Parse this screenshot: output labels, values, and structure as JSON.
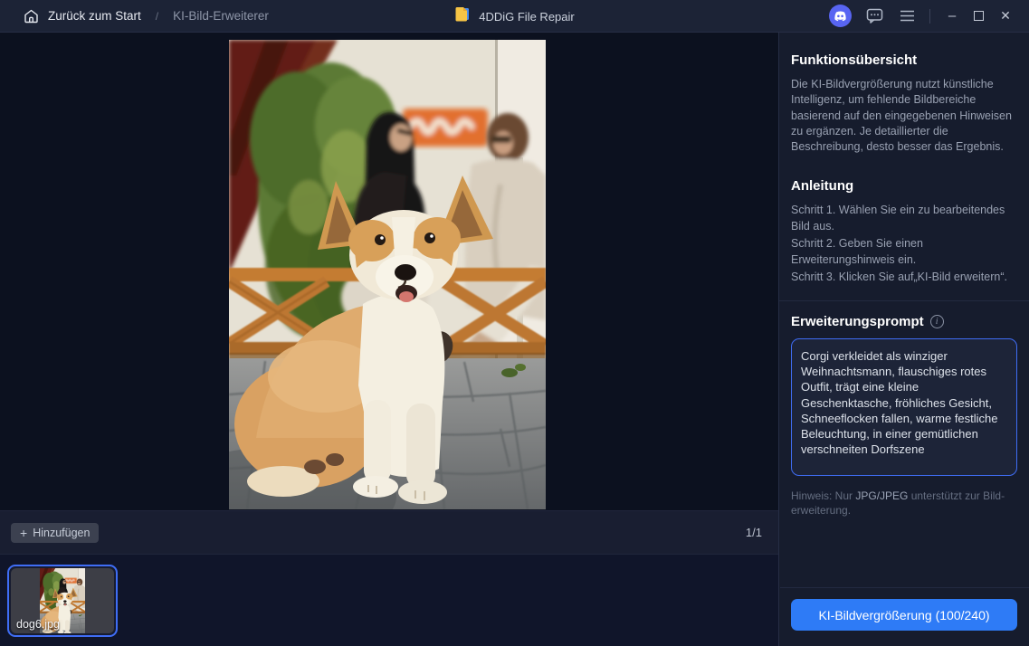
{
  "colors": {
    "accent_blue": "#2e7bf6",
    "discord_blue": "#5865f2",
    "selection_border": "#3f6df5"
  },
  "titlebar": {
    "back_label": "Zurück zum Start",
    "separator": "/",
    "current_page": "KI-Bild-Erweiterer",
    "app_title": "4DDiG File Repair",
    "minimize_glyph": "–",
    "close_glyph": "✕"
  },
  "preview_bar": {
    "plus_glyph": "+",
    "add_label": "Hinzufügen",
    "counter": "1/1"
  },
  "filmstrip": {
    "filename": "dog6.jpg"
  },
  "sidebar": {
    "overview_title": "Funktionsübersicht",
    "overview_text": "Die KI-Bildvergrößerung nutzt künstliche Intelligenz, um fehlende Bildbereiche basierend auf den eingegebenen Hinweisen zu ergänzen. Je detaillierter die Beschreibung, desto besser das Ergebnis.",
    "guide_title": "Anleitung",
    "guide_steps": [
      "Schritt 1. Wählen Sie ein zu bearbeitendes Bild aus.",
      "Schritt 2. Geben Sie einen Erweiterungshinweis ein.",
      "Schritt 3. Klicken Sie auf„KI-Bild erweitern“."
    ],
    "prompt_title": "Erweiterungsprompt",
    "info_glyph": "i",
    "prompt_value": "Corgi verkleidet als winziger Weihnachtsmann, flauschiges rotes Outfit, trägt eine kleine Geschenktasche, fröhliches Gesicht, Schneeflocken fallen, warme festliche Beleuchtung, in einer gemütlichen verschneiten Dorfszene",
    "hint_prefix": "Hinweis: Nur ",
    "hint_strong": "JPG/JPEG",
    "hint_suffix": " unterstützt zur Bild-erweiterung.",
    "action_label": "KI-Bildvergrößerung (100/240)"
  }
}
